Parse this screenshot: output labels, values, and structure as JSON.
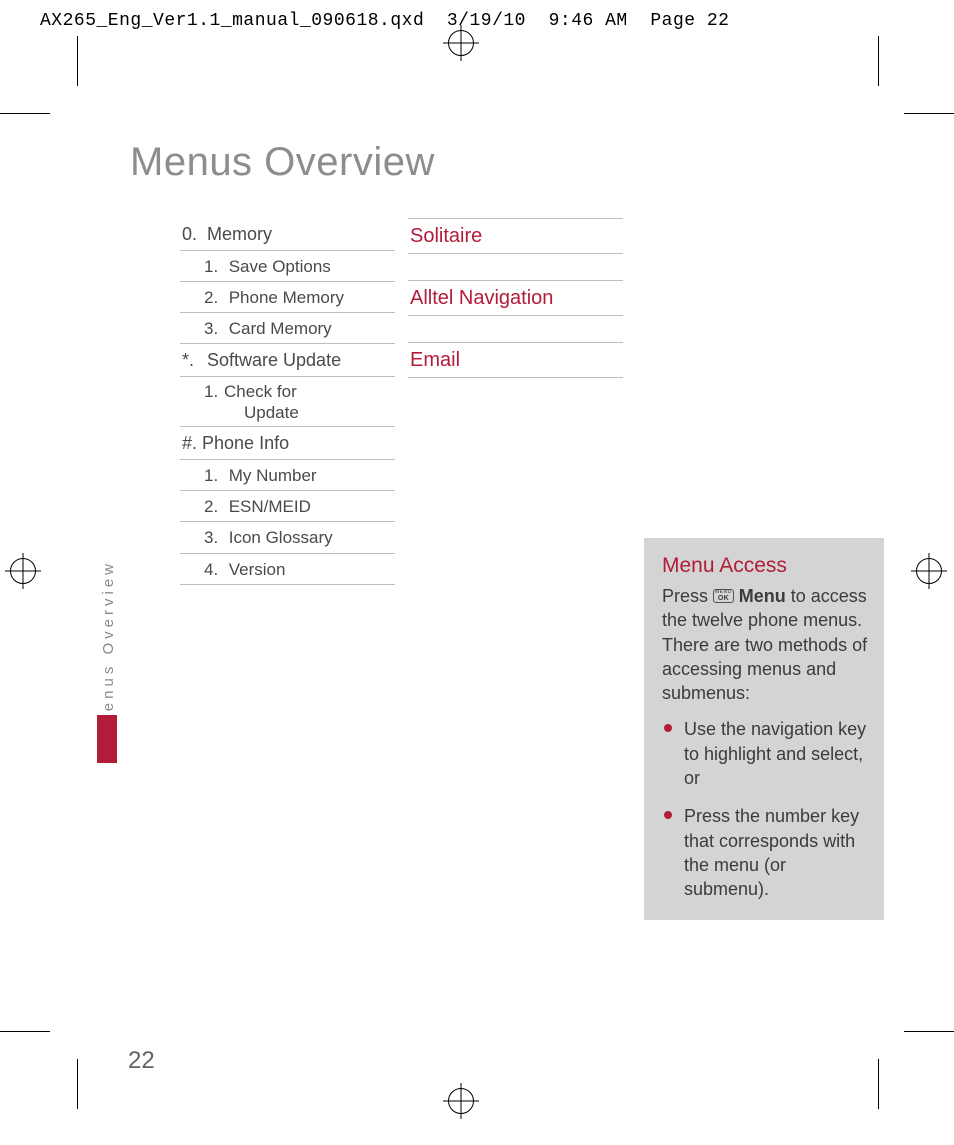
{
  "header": {
    "filename": "AX265_Eng_Ver1.1_manual_090618.qxd",
    "date": "3/19/10",
    "time": "9:46 AM",
    "page_label": "Page 22"
  },
  "title": "Menus Overview",
  "side_label": "Menus Overview",
  "page_number": "22",
  "col1": [
    {
      "lvl": 0,
      "num": "0.",
      "text": "Memory"
    },
    {
      "lvl": 1,
      "num": "1.",
      "text": "Save Options"
    },
    {
      "lvl": 1,
      "num": "2.",
      "text": "Phone Memory"
    },
    {
      "lvl": 1,
      "num": "3.",
      "text": "Card Memory"
    },
    {
      "lvl": 0,
      "num": "*.",
      "text": "Software Update"
    },
    {
      "lvl": 1,
      "num": "1.",
      "text": "Check for",
      "text2": "Update"
    },
    {
      "lvl": 0,
      "num": "#.",
      "text": "Phone Info",
      "tight": true
    },
    {
      "lvl": 1,
      "num": "1.",
      "text": "My Number"
    },
    {
      "lvl": 1,
      "num": "2.",
      "text": "ESN/MEID"
    },
    {
      "lvl": 1,
      "num": "3.",
      "text": "Icon Glossary"
    },
    {
      "lvl": 1,
      "num": "4.",
      "text": "Version"
    }
  ],
  "col2": [
    "Solitaire",
    "Alltel Navigation",
    "Email"
  ],
  "box": {
    "title": "Menu Access",
    "press": "Press ",
    "menu_word": "Menu",
    "after_menu": " to access the twelve phone menus. There are two methods of accessing menus and submenus:",
    "bullets": [
      "Use the navigation key to highlight and select, or",
      "Press the number key that corresponds with the menu \n(or submenu)."
    ]
  }
}
